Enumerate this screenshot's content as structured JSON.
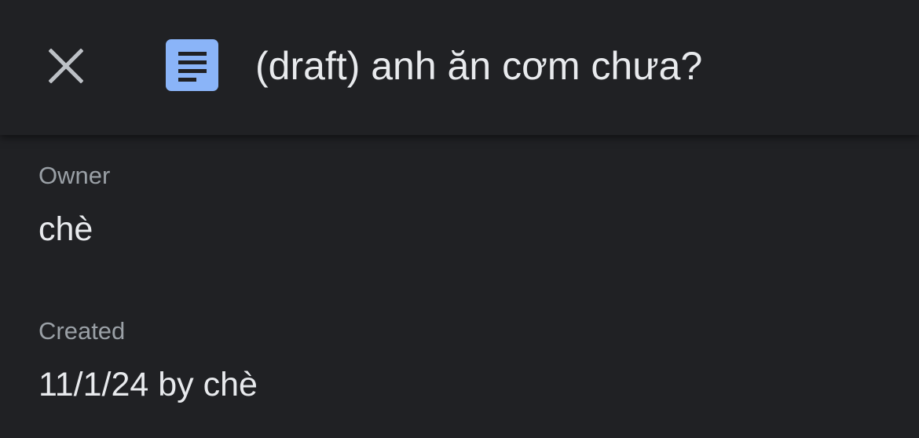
{
  "header": {
    "close_icon": "close-icon",
    "doc_icon": "google-docs-icon",
    "doc_icon_color": "#8ab4f8",
    "title": "(draft) anh ăn cơm chưa?"
  },
  "details": {
    "owner": {
      "label": "Owner",
      "value": "chè"
    },
    "created": {
      "label": "Created",
      "value": "11/1/24 by chè"
    }
  },
  "colors": {
    "background": "#202124",
    "primary_text": "#e8eaed",
    "secondary_text": "#9aa0a6"
  }
}
